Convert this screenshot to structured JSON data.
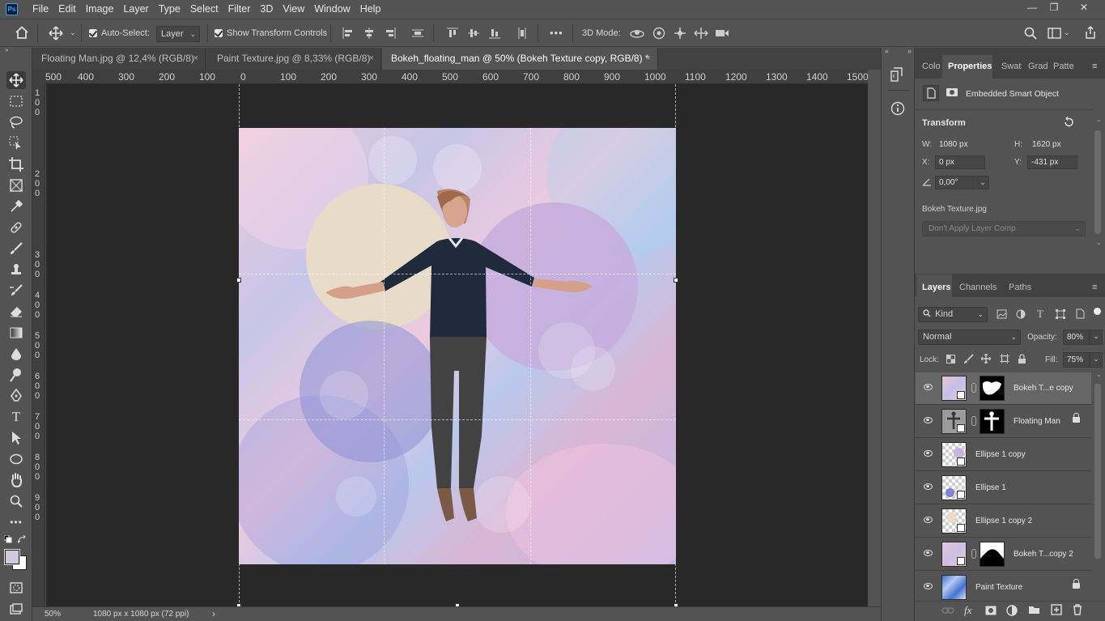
{
  "app": {
    "logo": "Ps"
  },
  "menu": [
    "File",
    "Edit",
    "Image",
    "Layer",
    "Type",
    "Select",
    "Filter",
    "3D",
    "View",
    "Window",
    "Help"
  ],
  "window_controls": {
    "minimize": "—",
    "restore": "❐",
    "close": "✕"
  },
  "options": {
    "auto_select_label": "Auto-Select:",
    "auto_select_value": "Layer",
    "show_transform_label": "Show Transform Controls",
    "more": "•••",
    "mode_3d_label": "3D Mode:"
  },
  "tabs": [
    {
      "label": "Floating Man.jpg @ 12,4% (RGB/8)",
      "close": "×"
    },
    {
      "label": "Paint Texture.jpg @ 8,33% (RGB/8)",
      "close": "×"
    },
    {
      "label": "Bokeh_floating_man @ 50% (Bokeh Texture copy, RGB/8) *",
      "close": "×"
    }
  ],
  "ruler_top": [
    "500",
    "400",
    "300",
    "200",
    "100",
    "0",
    "100",
    "200",
    "300",
    "400",
    "500",
    "600",
    "700",
    "800",
    "900",
    "1000",
    "1100",
    "1200",
    "1300",
    "1400",
    "1500"
  ],
  "ruler_left": [
    "1",
    "0",
    "0",
    "2",
    "0",
    "0",
    "3",
    "0",
    "0",
    "4",
    "0",
    "0",
    "5",
    "0",
    "0",
    "6",
    "0",
    "0",
    "7",
    "0",
    "0",
    "8",
    "0",
    "0",
    "9",
    "0",
    "0"
  ],
  "status": {
    "zoom": "50%",
    "doc_info": "1080 px x 1080 px (72 ppi)",
    "arrow": "›"
  },
  "properties_panel": {
    "tabs": [
      "Colo",
      "Properties",
      "Swat",
      "Grad",
      "Patte"
    ],
    "object_type": "Embedded Smart Object",
    "section_title": "Transform",
    "w_label": "W:",
    "w_value": "1080 px",
    "h_label": "H:",
    "h_value": "1620 px",
    "x_label": "X:",
    "x_value": "0 px",
    "y_label": "Y:",
    "y_value": "-431 px",
    "angle_value": "0,00°",
    "linked_file": "Bokeh Texture.jpg",
    "layer_comp": "Don't Apply Layer Comp"
  },
  "layers_panel": {
    "tabs": [
      "Layers",
      "Channels",
      "Paths"
    ],
    "filter_kind": "Kind",
    "blend_mode": "Normal",
    "opacity_label": "Opacity:",
    "opacity_value": "80%",
    "lock_label": "Lock:",
    "fill_label": "Fill:",
    "fill_value": "75%",
    "layers": [
      {
        "name": "Bokeh T...e copy",
        "selected": true,
        "locked": false
      },
      {
        "name": "Floating Man",
        "selected": false,
        "locked": true
      },
      {
        "name": "Ellipse 1 copy",
        "selected": false,
        "locked": false
      },
      {
        "name": "Ellipse 1",
        "selected": false,
        "locked": false
      },
      {
        "name": "Ellipse 1 copy 2",
        "selected": false,
        "locked": false
      },
      {
        "name": "Bokeh T...copy 2",
        "selected": false,
        "locked": false
      },
      {
        "name": "Paint Texture",
        "selected": false,
        "locked": true
      }
    ]
  },
  "colors": {
    "foreground": "#d3c7de",
    "background": "#ffffff",
    "accent": "#31a8ff"
  }
}
